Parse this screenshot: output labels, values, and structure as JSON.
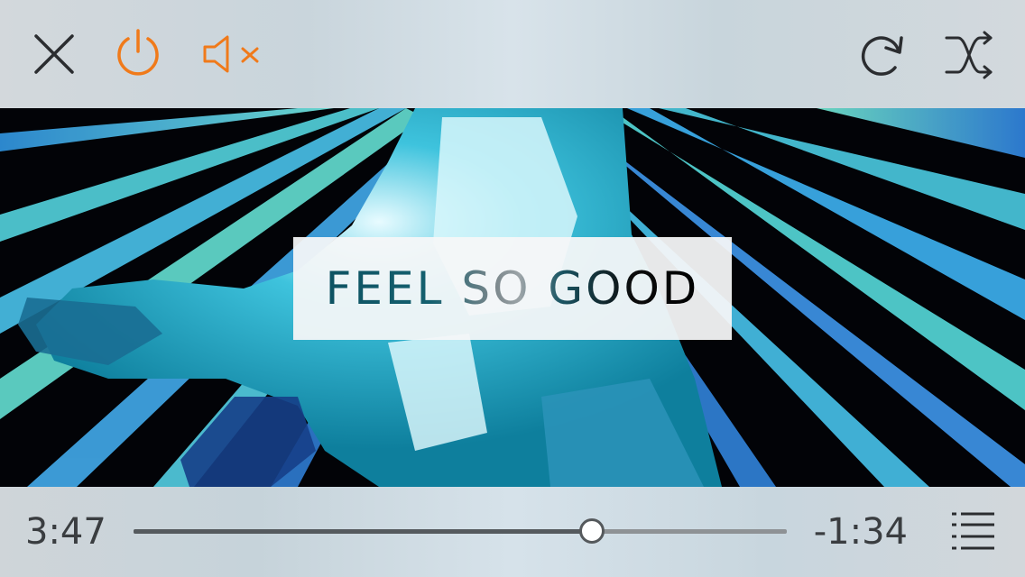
{
  "colors": {
    "accent": "#f07a1a",
    "icon_dark": "#2b2d30",
    "text": "#3a3d40",
    "track": "#8e9295",
    "track_fill": "#555a5e"
  },
  "toolbar": {
    "left": [
      {
        "name": "close",
        "icon": "close-icon"
      },
      {
        "name": "power",
        "icon": "power-icon"
      },
      {
        "name": "mute",
        "icon": "speaker-muted-icon"
      }
    ],
    "right": [
      {
        "name": "repeat",
        "icon": "repeat-icon"
      },
      {
        "name": "shuffle",
        "icon": "shuffle-icon"
      }
    ]
  },
  "video": {
    "title_overlay": "FEEL SO GOOD"
  },
  "playback": {
    "elapsed": "3:47",
    "remaining": "-1:34",
    "progress_fraction": 0.7,
    "playlist_icon": "playlist-icon"
  }
}
